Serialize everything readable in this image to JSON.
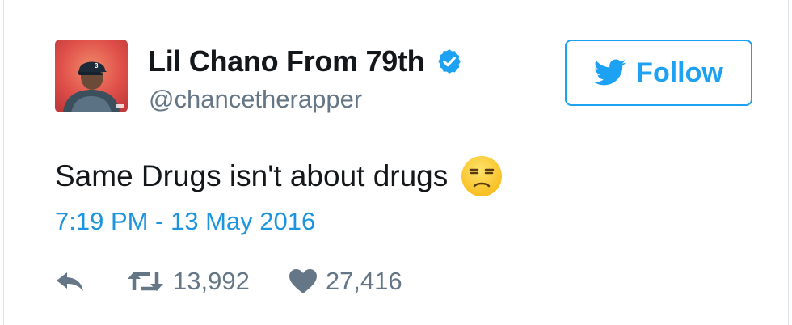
{
  "tweet": {
    "display_name": "Lil Chano From 79th",
    "handle": "@chancetherapper",
    "text": "Same Drugs isn't about drugs",
    "timestamp": "7:19 PM - 13 May 2016",
    "retweet_count": "13,992",
    "like_count": "27,416"
  },
  "follow_button": {
    "label": "Follow",
    "icon": "twitter-bird-icon"
  },
  "icons": {
    "verified": "verified-badge-icon",
    "emoji": "unamused-face-emoji",
    "reply": "reply-icon",
    "retweet": "retweet-icon",
    "like": "heart-icon"
  },
  "colors": {
    "brand_blue": "#1da1f2",
    "link_blue": "#1b95e0",
    "secondary_text": "#657786",
    "primary_text": "#14171a"
  }
}
